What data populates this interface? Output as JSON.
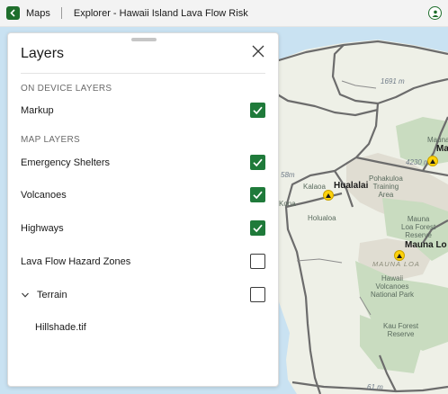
{
  "titlebar": {
    "app": "Maps",
    "title": "Explorer - Hawaii Island Lava Flow Risk"
  },
  "panel": {
    "title": "Layers",
    "sections": [
      {
        "heading": "ON DEVICE LAYERS"
      },
      {
        "heading": "MAP LAYERS"
      }
    ],
    "rows": [
      {
        "label": "Markup",
        "checked": true
      },
      {
        "label": "Emergency Shelters",
        "checked": true
      },
      {
        "label": "Volcanoes",
        "checked": true
      },
      {
        "label": "Highways",
        "checked": true
      },
      {
        "label": "Lava Flow Hazard Zones",
        "checked": false
      },
      {
        "label": "Terrain",
        "checked": false
      },
      {
        "label": "Hillshade.tif"
      }
    ]
  },
  "map": {
    "labels": {
      "mauna_kea_short": "Ma",
      "mauna_kea_sub": "Mauna",
      "elev_4230": "4230 m",
      "elev_1691": "1691 m",
      "elev_58": "58m",
      "elev_61": "61 m",
      "hualalai": "Hualalai",
      "kalaoa": "Kalaoa",
      "kona": "Kona",
      "holualoa": "Holualoa",
      "pohakuloa_1": "Pohakuloa",
      "pohakuloa_2": "Training",
      "pohakuloa_3": "Area",
      "mlfr_1": "Mauna",
      "mlfr_2": "Loa Forest",
      "mlfr_3": "Reserve",
      "mauna_loa": "Mauna Lo",
      "mauna_loa_caps": "MAUNA LOA",
      "hvnp_1": "Hawaii",
      "hvnp_2": "Volcanoes",
      "hvnp_3": "National Park",
      "kau_1": "Kau Forest",
      "kau_2": "Reserve"
    },
    "colors": {
      "ocean": "#c9e2f2",
      "land": "#eef0e7",
      "forest": "#c9dcc0",
      "highland": "#e0ddd2",
      "road": "#6c6c6c",
      "accent": "#1f7a3a"
    }
  }
}
